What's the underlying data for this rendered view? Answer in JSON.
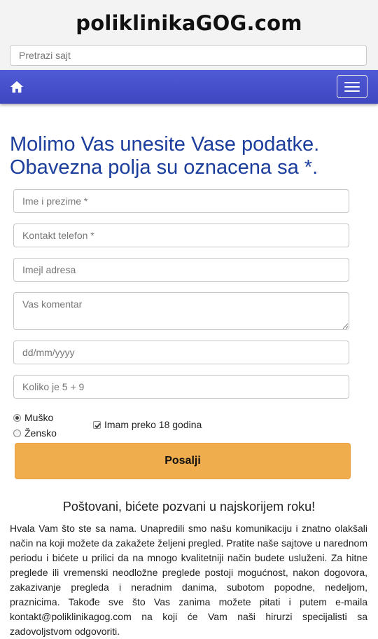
{
  "header": {
    "site_title": "poliklinikaGOG.com",
    "search_placeholder": "Pretrazi sajt"
  },
  "navbar": {
    "home_icon": "home-icon",
    "menu_icon": "hamburger-menu-icon",
    "background_color": "#4a52cf"
  },
  "form": {
    "heading_line1": "Molimo Vas unesite Vase podatke.",
    "heading_line2": "Obavezna polja su oznacena sa *.",
    "fields": {
      "name_placeholder": "Ime i prezime *",
      "phone_placeholder": "Kontakt telefon *",
      "email_placeholder": "Imejl adresa",
      "comment_placeholder": "Vas komentar",
      "date_placeholder": "dd/mm/yyyy",
      "captcha_placeholder": "Koliko je 5 + 9"
    },
    "gender": {
      "male_label": "Muško",
      "female_label": "Žensko",
      "selected": "Muško"
    },
    "age_checkbox": {
      "label": "Imam preko 18 godina",
      "checked": true
    },
    "submit_label": "Posalji",
    "submit_color": "#f0ad4e"
  },
  "thanks": {
    "title": "Poštovani, bićete pozvani u najskorijem roku!",
    "body": "Hvala Vam što ste sa nama. Unapredili smo našu komunikaciju i znatno olakšali način na koji možete da zakažete željeni pregled. Pratite naše sajtove u narednom periodu i bićete u prilici da na mnogo kvalitetniji način budete usluženi. Za hitne preglede ili vremenski neodložne preglede postoji mogućnost, nakon dogovora, zakazivanje pregleda i neradnim danima, subotom popodne, nedeljom, praznicima. Takođe sve što Vas zanima možete pitati i putem e-maila kontakt@poliklinikagog.com na koji će Vam naši hirurzi specijalisti sa zadovoljstvom odgovoriti."
  },
  "colors": {
    "heading": "#1b3d9c",
    "header_bg": "#f3f3f3"
  }
}
